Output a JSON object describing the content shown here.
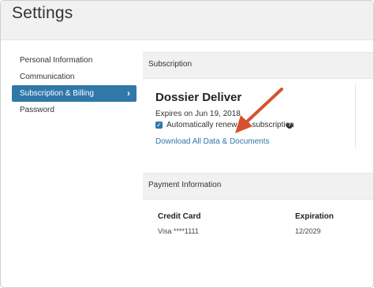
{
  "page": {
    "title": "Settings"
  },
  "sidebar": {
    "items": [
      {
        "label": "Personal Information"
      },
      {
        "label": "Communication"
      },
      {
        "label": "Subscription & Billing",
        "active": true
      },
      {
        "label": "Password"
      }
    ],
    "chevron": "›"
  },
  "subscription": {
    "header": "Subscription",
    "plan_name": "Dossier Deliver",
    "expires": "Expires on Jun 19, 2018",
    "auto_renew_label": "Automatically renew my subscription",
    "auto_renew_checked": true,
    "help_icon": "question-circle-icon",
    "download_link": "Download All Data & Documents"
  },
  "payment": {
    "header": "Payment Information",
    "columns": [
      "Credit Card",
      "Expiration"
    ],
    "card_value": "Visa ****1111",
    "expiration_value": "12/2029"
  },
  "annotation": {
    "arrow_color": "#d4532e"
  },
  "colors": {
    "accent": "#2f78a8",
    "header_bg": "#f1f1f1"
  }
}
